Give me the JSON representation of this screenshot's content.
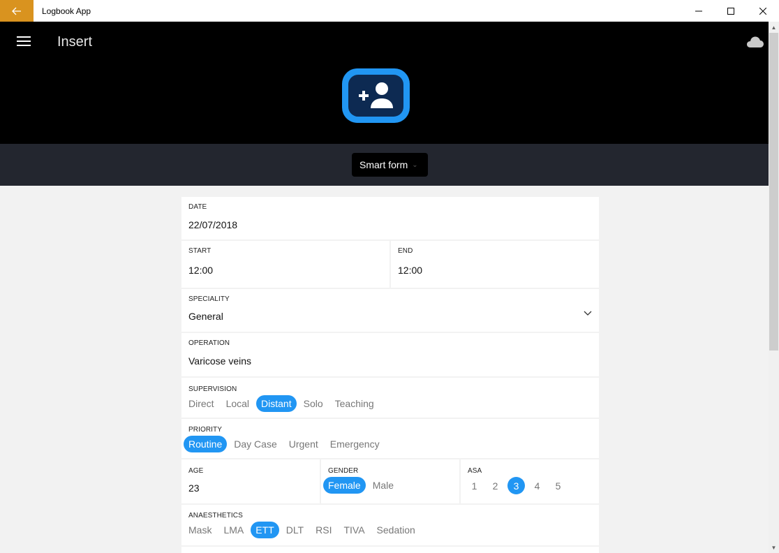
{
  "window": {
    "title": "Logbook App"
  },
  "header": {
    "title": "Insert"
  },
  "subbar": {
    "form_type": "Smart form"
  },
  "form": {
    "date": {
      "label": "DATE",
      "value": "22/07/2018"
    },
    "start": {
      "label": "START",
      "value": "12:00"
    },
    "end": {
      "label": "END",
      "value": "12:00"
    },
    "speciality": {
      "label": "SPECIALITY",
      "value": "General"
    },
    "operation": {
      "label": "OPERATION",
      "value": "Varicose veins"
    },
    "supervision": {
      "label": "SUPERVISION",
      "options": [
        "Direct",
        "Local",
        "Distant",
        "Solo",
        "Teaching"
      ],
      "selected": "Distant"
    },
    "priority": {
      "label": "PRIORITY",
      "options": [
        "Routine",
        "Day Case",
        "Urgent",
        "Emergency"
      ],
      "selected": "Routine"
    },
    "age": {
      "label": "AGE",
      "value": "23"
    },
    "gender": {
      "label": "GENDER",
      "options": [
        "Female",
        "Male"
      ],
      "selected": "Female"
    },
    "asa": {
      "label": "ASA",
      "options": [
        "1",
        "2",
        "3",
        "4",
        "5"
      ],
      "selected": "3"
    },
    "anaesthetics": {
      "label": "ANAESTHETICS",
      "options": [
        "Mask",
        "LMA",
        "ETT",
        "DLT",
        "RSI",
        "TIVA",
        "Sedation"
      ],
      "selected": "ETT"
    }
  },
  "colors": {
    "accent": "#2196f3",
    "back_button": "#d9931f",
    "header": "#000000",
    "subbar": "#23262f"
  },
  "icons": {
    "back": "arrow-left-icon",
    "menu": "hamburger-icon",
    "sync": "cloud-icon",
    "hero": "add-person-icon",
    "dropdown": "chevron-down-icon"
  }
}
